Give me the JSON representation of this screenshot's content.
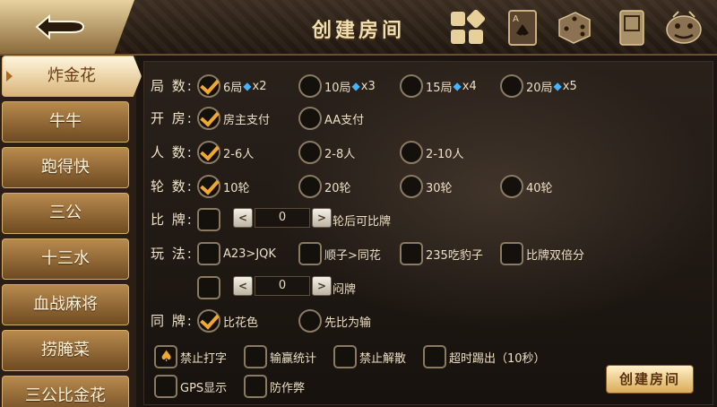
{
  "header": {
    "title": "创建房间"
  },
  "sidebar": {
    "items": [
      {
        "label": "炸金花"
      },
      {
        "label": "牛牛"
      },
      {
        "label": "跑得快"
      },
      {
        "label": "三公"
      },
      {
        "label": "十三水"
      },
      {
        "label": "血战麻将"
      },
      {
        "label": "捞腌菜"
      },
      {
        "label": "三公比金花"
      }
    ]
  },
  "form": {
    "rounds": {
      "label": "局 数:",
      "options": [
        {
          "text": "6局",
          "cost": "x2",
          "checked": true
        },
        {
          "text": "10局",
          "cost": "x3",
          "checked": false
        },
        {
          "text": "15局",
          "cost": "x4",
          "checked": false
        },
        {
          "text": "20局",
          "cost": "x5",
          "checked": false
        }
      ]
    },
    "open_room": {
      "label": "开 房:",
      "options": [
        {
          "text": "房主支付",
          "checked": true
        },
        {
          "text": "AA支付",
          "checked": false
        }
      ]
    },
    "players": {
      "label": "人 数:",
      "options": [
        {
          "text": "2-6人",
          "checked": true
        },
        {
          "text": "2-8人",
          "checked": false
        },
        {
          "text": "2-10人",
          "checked": false
        }
      ]
    },
    "turns": {
      "label": "轮 数:",
      "options": [
        {
          "text": "10轮",
          "checked": true
        },
        {
          "text": "20轮",
          "checked": false
        },
        {
          "text": "30轮",
          "checked": false
        },
        {
          "text": "40轮",
          "checked": false
        }
      ]
    },
    "compare": {
      "label": "比 牌:",
      "value": "0",
      "suffix": "轮后可比牌"
    },
    "play": {
      "label": "玩 法:",
      "options": [
        {
          "text": "A23>JQK",
          "checked": false
        },
        {
          "text": "顺子>同花",
          "checked": false
        },
        {
          "text": "235吃豹子",
          "checked": false
        },
        {
          "text": "比牌双倍分",
          "checked": false
        }
      ],
      "blind_value": "0",
      "blind_suffix": "闷牌"
    },
    "same_hand": {
      "label": "同 牌:",
      "options": [
        {
          "text": "比花色",
          "checked": true
        },
        {
          "text": "先比为输",
          "checked": false
        }
      ]
    },
    "extras": [
      {
        "text": "禁止打字",
        "checked": true
      },
      {
        "text": "输赢统计",
        "checked": false
      },
      {
        "text": "禁止解散",
        "checked": false
      },
      {
        "text": "超时踢出（10秒）",
        "checked": false
      },
      {
        "text": "GPS显示",
        "checked": false
      },
      {
        "text": "防作弊",
        "checked": false
      }
    ]
  },
  "actions": {
    "create_label": "创建房间",
    "stepper_minus": "<",
    "stepper_plus": ">"
  },
  "icons": [
    "back-icon",
    "grid-icon",
    "card-icon",
    "dice-icon",
    "mahjong-icon",
    "lion-icon"
  ],
  "colors": {
    "accent": "#f0a830",
    "diamond": "#45b4ff",
    "gold": "#d9ac58"
  }
}
